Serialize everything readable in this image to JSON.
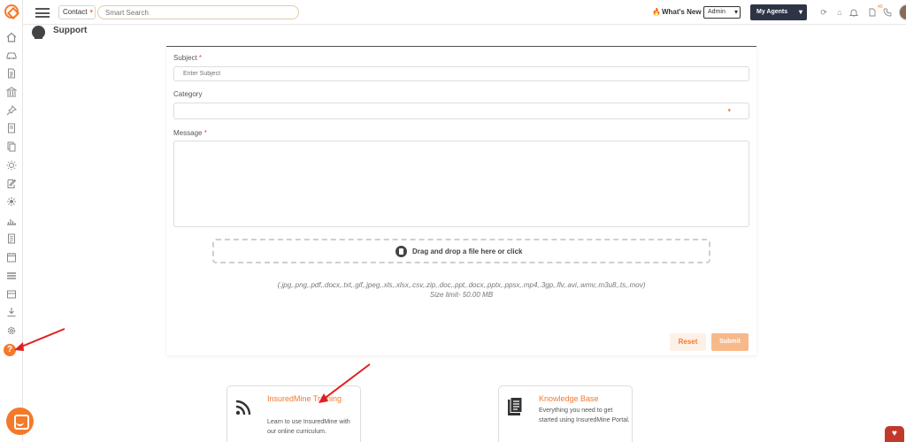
{
  "topbar": {
    "contact_select": "Contact",
    "search_placeholder": "Smart Search",
    "whats_new": "What's New",
    "admin_select": "Admin",
    "my_agents": "My Agents",
    "notification_count": "40"
  },
  "page": {
    "title": "Support"
  },
  "form": {
    "subject_label": "Subject",
    "subject_placeholder": "Enter Subject",
    "category_label": "Category",
    "message_label": "Message",
    "required_mark": "*",
    "drop_text": "Drag and drop a file here or click",
    "file_types": "(.jpg,.png,.pdf,.docx,.txt,.gif,.jpeg,.xls,.xlsx,.csv,.zip,.doc,.ppt,.docx,.pptx,.ppsx,.mp4,.3gp,.flv,.avi,.wmv,.m3u8,.ts,.mov) Size limit- 50.00 MB",
    "reset_label": "Reset",
    "submit_label": "Submit"
  },
  "help_cards": [
    {
      "icon": "rss-icon",
      "title": "InsuredMine Training",
      "description": "Learn to use InsuredMine with our online curriculum."
    },
    {
      "icon": "document-icon",
      "title": "Knowledge Base",
      "description": "Everything you need to get started using InsuredMine Portal."
    }
  ],
  "sidebar": {
    "icons": [
      "home-icon",
      "car-icon",
      "document-icon",
      "bank-icon",
      "pin-icon",
      "book-icon",
      "files-icon",
      "sun-icon",
      "edit-icon",
      "settings-sun-icon",
      "chart-icon",
      "report-icon",
      "calendar-icon",
      "stack-icon",
      "download-icon",
      "gear-icon",
      "help-icon"
    ]
  },
  "colors": {
    "accent": "#f37a2b",
    "dark_button": "#2d3445",
    "arrow": "#e02020"
  }
}
